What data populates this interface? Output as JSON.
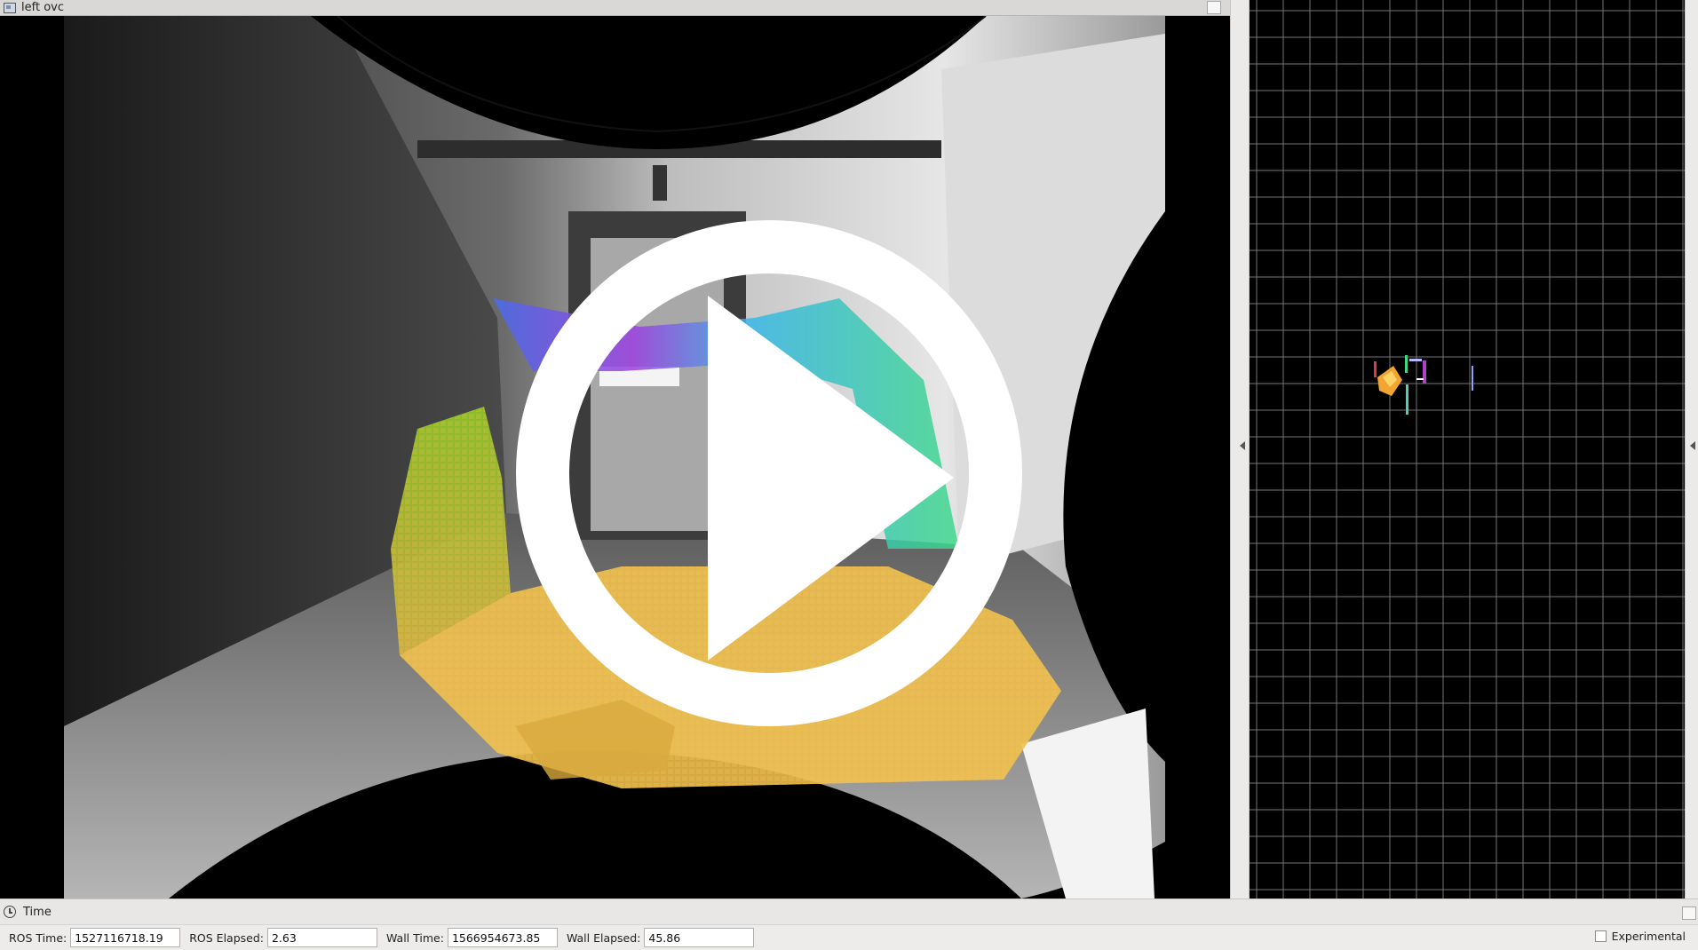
{
  "camera_panel": {
    "title": "left ovc"
  },
  "time_panel": {
    "title": "Time",
    "ros_time_label": "ROS Time:",
    "ros_time_value": "1527116718.19",
    "ros_elapsed_label": "ROS Elapsed:",
    "ros_elapsed_value": "2.63",
    "wall_time_label": "Wall Time:",
    "wall_time_value": "1566954673.85",
    "wall_elapsed_label": "Wall Elapsed:",
    "wall_elapsed_value": "45.86",
    "experimental_label": "Experimental"
  },
  "colors": {
    "grid_line": "#8a8a8a",
    "point_cloud_floor": "#f2c14e",
    "point_cloud_wall": "#9acb2a",
    "point_cloud_ceiling": "#3b8ef0",
    "play_overlay": "#ffffff"
  },
  "icons": {
    "play": "play-icon",
    "clock": "clock-icon",
    "window": "window-icon"
  }
}
